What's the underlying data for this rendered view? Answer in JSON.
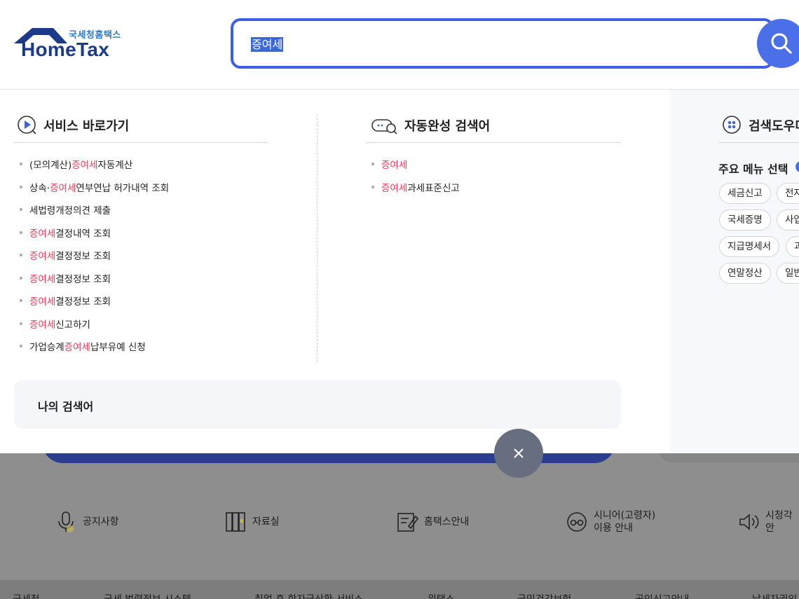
{
  "logo": {
    "small": "국세청홈택스",
    "big": "HomeTax"
  },
  "search": {
    "value": "증여세"
  },
  "services": {
    "title": "서비스 바로가기",
    "items": [
      {
        "pre": "(모의계산) ",
        "hl": "증여세",
        "post": " 자동계산"
      },
      {
        "pre": "상속·",
        "hl": "증여세",
        "post": " 연부연납 허가내역 조회"
      },
      {
        "pre": "세법령개정의견 제출",
        "hl": "",
        "post": ""
      },
      {
        "pre": "",
        "hl": "증여세",
        "post": " 결정내역 조회"
      },
      {
        "pre": "",
        "hl": "증여세",
        "post": " 결정정보 조회"
      },
      {
        "pre": "",
        "hl": "증여세",
        "post": " 결정정보 조회"
      },
      {
        "pre": "",
        "hl": "증여세",
        "post": " 결정정보 조회"
      },
      {
        "pre": "",
        "hl": "증여세",
        "post": " 신고하기"
      },
      {
        "pre": "가업승계 ",
        "hl": "증여세",
        "post": " 납부유예 신청"
      }
    ]
  },
  "autocomplete": {
    "title": "자동완성 검색어",
    "items": [
      {
        "hl": "증여세",
        "post": ""
      },
      {
        "hl": "증여세",
        "post": "과세표준신고"
      }
    ]
  },
  "my_search": {
    "title": "나의 검색어"
  },
  "search_helper": {
    "title": "검색도우미",
    "menu_label": "주요 메뉴 선택",
    "chips": [
      "세금신고",
      "전자",
      "국세증명",
      "사업",
      "지급명세서",
      "과",
      "연말정산",
      "일반"
    ]
  },
  "quick_links": [
    {
      "label": "공지사항",
      "icon": "microphone-icon"
    },
    {
      "label": "자료실",
      "icon": "archive-icon"
    },
    {
      "label": "홈택스안내",
      "icon": "guide-icon"
    },
    {
      "label_line1": "시니어(고령자)",
      "label_line2": "이용 안내",
      "icon": "senior-icon"
    },
    {
      "label": "시청각안",
      "icon": "speaker-icon"
    }
  ],
  "footer_links": [
    "국세청",
    "국세 법령정보 시스템",
    "취업 후 학자금상환 서비스",
    "위택스",
    "국민건강보험",
    "공인신고안내",
    "납세자권익"
  ],
  "colors": {
    "accent": "#3d5fe0",
    "highlight": "#e0405a",
    "brand": "#1b3a8c"
  }
}
